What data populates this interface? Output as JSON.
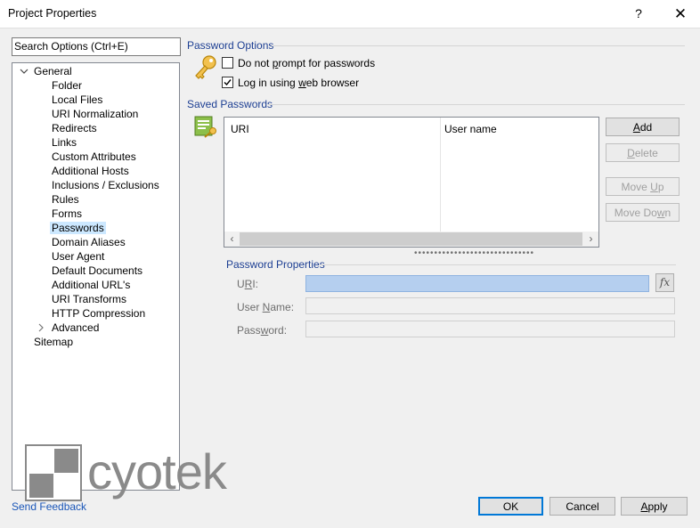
{
  "window": {
    "title": "Project Properties",
    "help_label": "?",
    "close_label": "✕"
  },
  "search": {
    "placeholder": "Search Options (Ctrl+E)"
  },
  "tree": {
    "root_general": "General",
    "children": [
      "Folder",
      "Local Files",
      "URI Normalization",
      "Redirects",
      "Links",
      "Custom Attributes",
      "Additional Hosts",
      "Inclusions / Exclusions",
      "Rules",
      "Forms",
      "Passwords",
      "Domain Aliases",
      "User Agent",
      "Default Documents",
      "Additional URL's",
      "URI Transforms",
      "HTTP Compression",
      "Advanced"
    ],
    "selected": "Passwords",
    "root_sitemap": "Sitemap"
  },
  "password_options": {
    "heading": "Password Options",
    "do_not_prompt": {
      "pre": "Do not ",
      "accel": "p",
      "post": "rompt for passwords",
      "checked": false
    },
    "log_in_browser": {
      "pre": "Log in using ",
      "accel": "w",
      "post": "eb browser",
      "checked": true
    }
  },
  "saved_passwords": {
    "heading": "Saved Passwords",
    "columns": [
      "URI",
      "User name"
    ],
    "buttons": {
      "add": {
        "accel": "A",
        "rest": "dd"
      },
      "delete": {
        "accel": "D",
        "rest": "elete"
      },
      "move_up": {
        "pre": "Move ",
        "accel": "U",
        "post": "p"
      },
      "move_down": {
        "pre": "Move Do",
        "accel": "w",
        "post": "n"
      }
    }
  },
  "password_properties": {
    "heading": "Password Properties",
    "uri_label": {
      "pre": "U",
      "accel": "R",
      "post": "I:"
    },
    "user_label": {
      "pre": "User ",
      "accel": "N",
      "post": "ame:"
    },
    "password_label": {
      "pre": "Pass",
      "accel": "w",
      "post": "ord:"
    },
    "fx_label": "fx"
  },
  "footer": {
    "send_feedback": "Send Feedback",
    "ok": "OK",
    "cancel": "Cancel",
    "apply_accel": "A",
    "apply_rest": "pply",
    "logo": "cyotek"
  },
  "colors": {
    "accent": "#0078d7",
    "group_heading": "#1d3f93",
    "selection": "#cce8ff"
  }
}
